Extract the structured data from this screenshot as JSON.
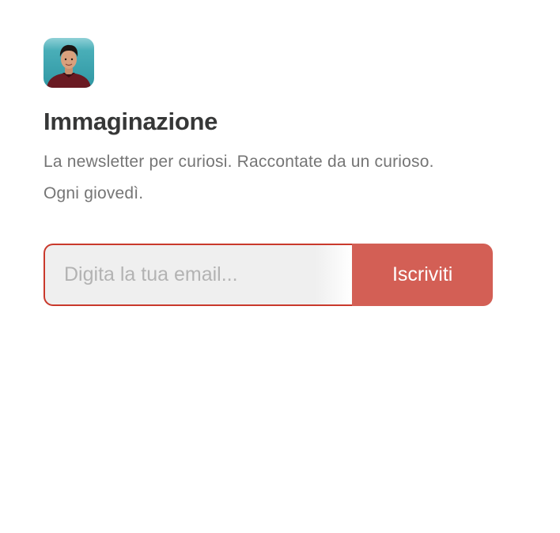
{
  "publication": {
    "avatar_icon": "person-portrait-avatar",
    "name": "Immaginazione",
    "description": "La newsletter per curiosi. Raccontate da un curioso. Ogni giovedì."
  },
  "subscribe": {
    "email_placeholder": "Digita la tua email...",
    "email_value": "",
    "button_label": "Iscriviti"
  },
  "colors": {
    "accent": "#d35f55",
    "input_border": "#c9392c",
    "title": "#363737",
    "description": "#757575",
    "input_background": "#efefef"
  }
}
